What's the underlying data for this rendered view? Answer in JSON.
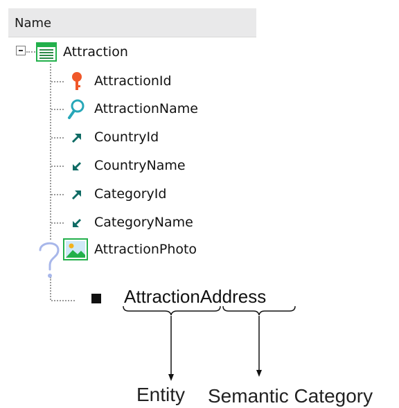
{
  "header": {
    "column_name": "Name"
  },
  "tree": {
    "root": {
      "label": "Attraction",
      "icon": "transaction-table-icon",
      "expanded": true
    },
    "children": [
      {
        "label": "AttractionId",
        "icon": "primary-key-icon"
      },
      {
        "label": "AttractionName",
        "icon": "descriptor-search-icon"
      },
      {
        "label": "CountryId",
        "icon": "foreign-key-arrow-icon"
      },
      {
        "label": "CountryName",
        "icon": "inferred-attribute-arrow-icon"
      },
      {
        "label": "CategoryId",
        "icon": "foreign-key-arrow-icon"
      },
      {
        "label": "CategoryName",
        "icon": "inferred-attribute-arrow-icon"
      },
      {
        "label": "AttractionPhoto",
        "icon": "image-icon"
      }
    ]
  },
  "annotation": {
    "new_attribute": "AttractionAddress",
    "question_mark": "?",
    "entity_label": "Entity",
    "semantic_label": "Semantic Category"
  },
  "colors": {
    "key_orange": "#f0582a",
    "search_teal": "#27a7b8",
    "arrow_teal": "#0f6b64",
    "table_green": "#22b04b",
    "question_blue": "#a8b7ea"
  }
}
